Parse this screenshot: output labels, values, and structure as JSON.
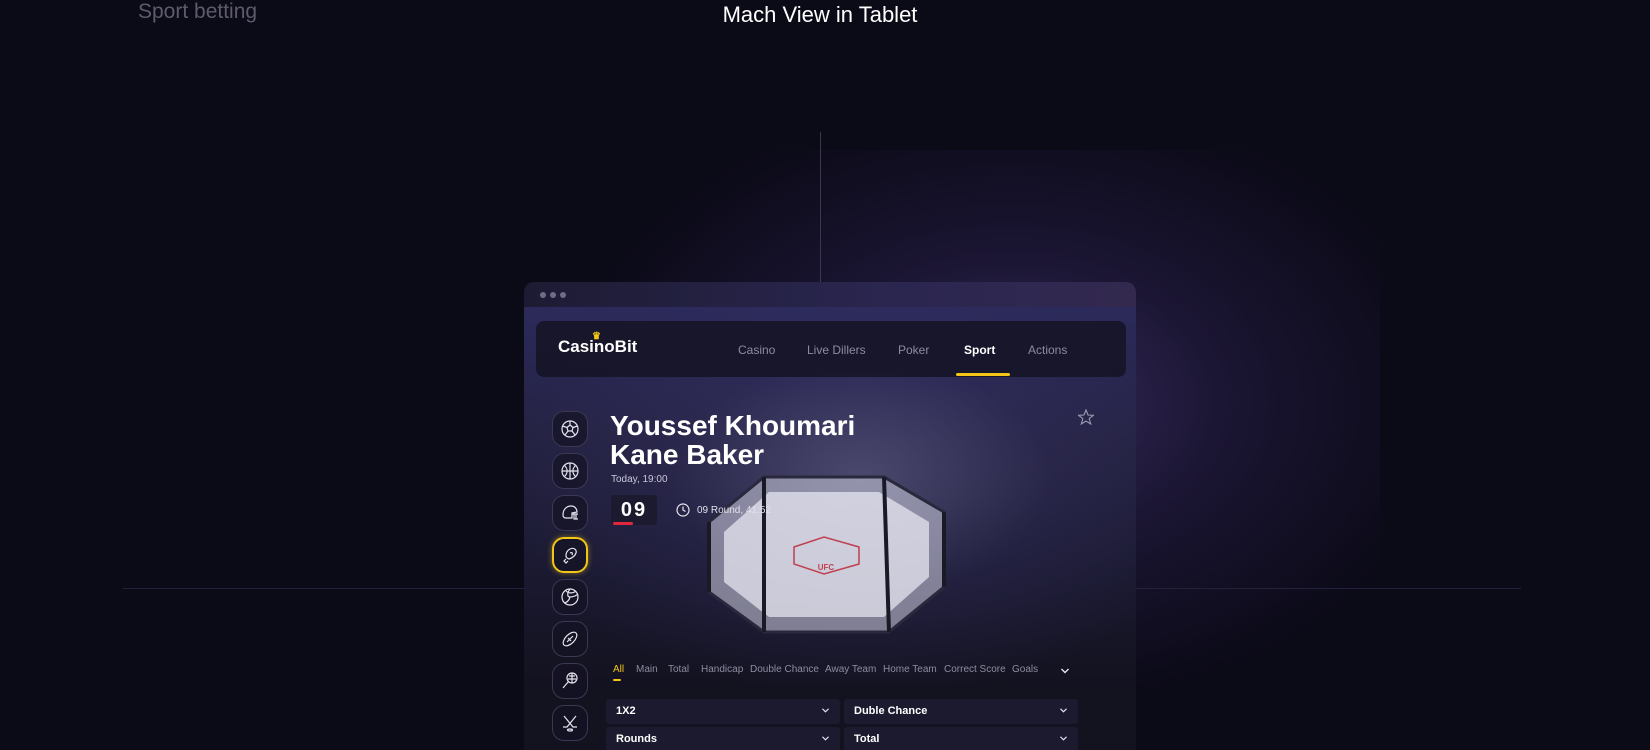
{
  "page": {
    "section_label": "Sport betting",
    "heading": "Mach View in Tablet"
  },
  "app": {
    "logo": "CasinoBit",
    "nav": [
      {
        "label": "Casino",
        "active": false
      },
      {
        "label": "Live Dillers",
        "active": false
      },
      {
        "label": "Poker",
        "active": false
      },
      {
        "label": "Sport",
        "active": true
      },
      {
        "label": "Actions",
        "active": false
      }
    ],
    "accent_color": "#f2c516",
    "sidebar": [
      {
        "icon": "soccer-ball-icon"
      },
      {
        "icon": "basketball-icon"
      },
      {
        "icon": "football-helmet-icon"
      },
      {
        "icon": "boxing-glove-icon",
        "active": true
      },
      {
        "icon": "volleyball-icon"
      },
      {
        "icon": "rugby-ball-icon"
      },
      {
        "icon": "tennis-racket-icon"
      },
      {
        "icon": "hockey-sticks-icon"
      }
    ],
    "match": {
      "fighter_1": "Youssef Khoumari",
      "fighter_2": "Kane Baker",
      "time": "Today, 19:00",
      "round_number": "09",
      "round_info": "09 Round,  41:52"
    },
    "tabs": [
      {
        "label": "All",
        "active": true
      },
      {
        "label": "Main"
      },
      {
        "label": "Total"
      },
      {
        "label": "Handicap"
      },
      {
        "label": "Double Chance"
      },
      {
        "label": "Away Team"
      },
      {
        "label": "Home Team"
      },
      {
        "label": "Correct Score"
      },
      {
        "label": "Goals"
      }
    ],
    "markets": [
      {
        "label": "1X2"
      },
      {
        "label": "Duble Chance"
      },
      {
        "label": "Rounds"
      },
      {
        "label": "Total"
      }
    ]
  }
}
